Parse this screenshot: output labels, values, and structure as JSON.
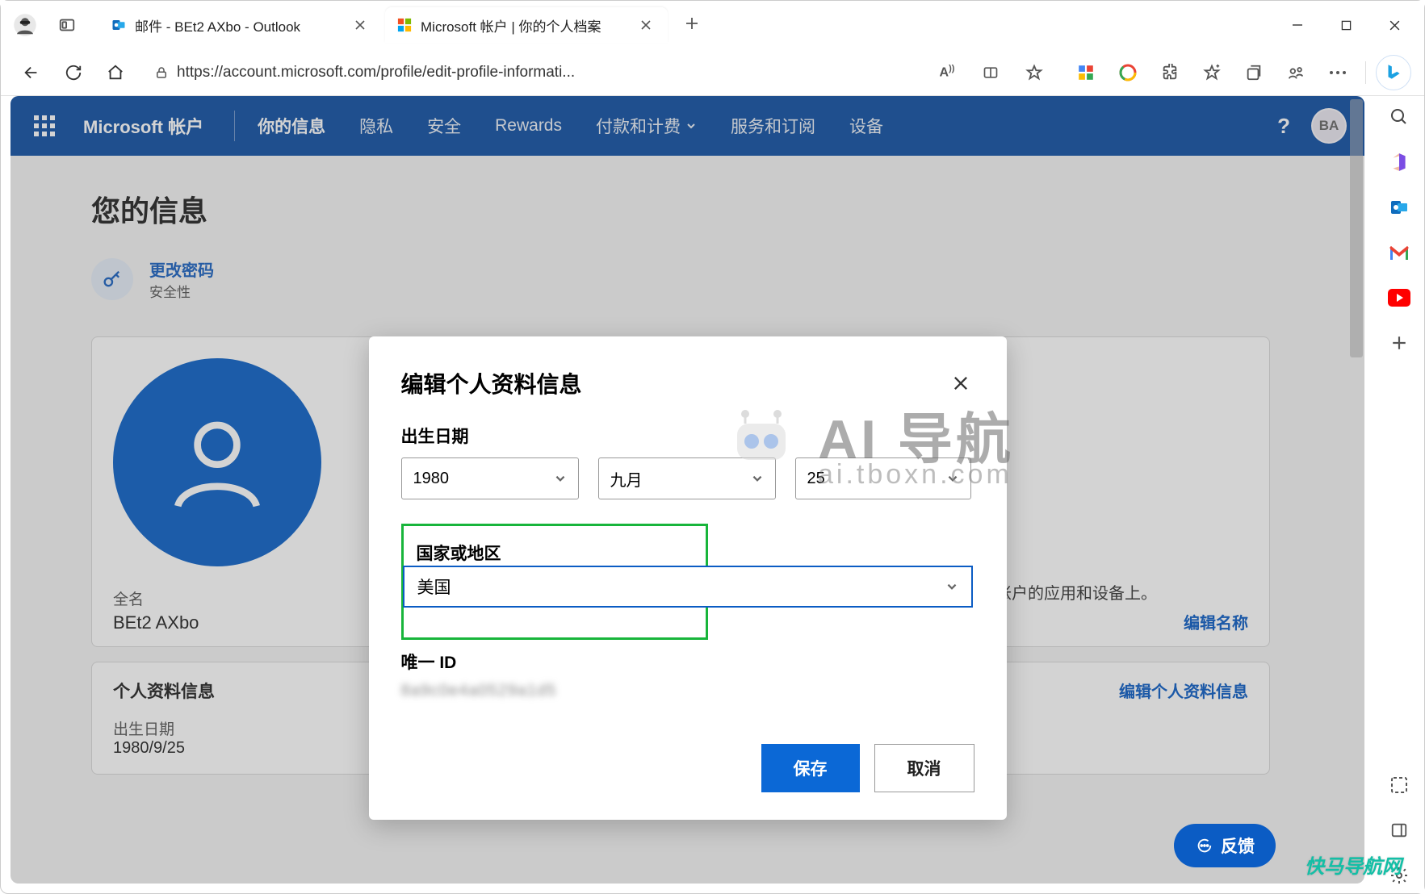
{
  "window": {
    "tabs": [
      {
        "title": "邮件 - BEt2 AXbo - Outlook"
      },
      {
        "title": "Microsoft 帐户 | 你的个人档案"
      }
    ]
  },
  "toolbar": {
    "url": "https://account.microsoft.com/profile/edit-profile-informati..."
  },
  "ms_header": {
    "brand": "Microsoft 帐户",
    "nav": [
      "你的信息",
      "隐私",
      "安全",
      "Rewards",
      "付款和计费",
      "服务和订阅",
      "设备"
    ],
    "avatar_initials": "BA"
  },
  "page": {
    "title": "您的信息",
    "change_password": {
      "title": "更改密码",
      "sub": "安全性"
    },
    "side_text": "帐户的应用和设备上。",
    "name_label": "全名",
    "name_value": "BEt2 AXbo",
    "edit_name_link": "编辑名称",
    "profile_section_title": "个人资料信息",
    "edit_profile_link": "编辑个人资料信息",
    "dob_label": "出生日期",
    "dob_value": "1980/9/25",
    "feedback": "反馈"
  },
  "modal": {
    "title": "编辑个人资料信息",
    "dob_label": "出生日期",
    "year": "1980",
    "month": "九月",
    "day": "25",
    "region_label": "国家或地区",
    "region_value": "美国",
    "uid_label": "唯一 ID",
    "uid_value": "8a9c0e4a0529a1d5",
    "save": "保存",
    "cancel": "取消"
  },
  "watermark": {
    "main": "AI 导航",
    "sub": "ai.tboxn.com",
    "bottom": "快马导航网"
  }
}
